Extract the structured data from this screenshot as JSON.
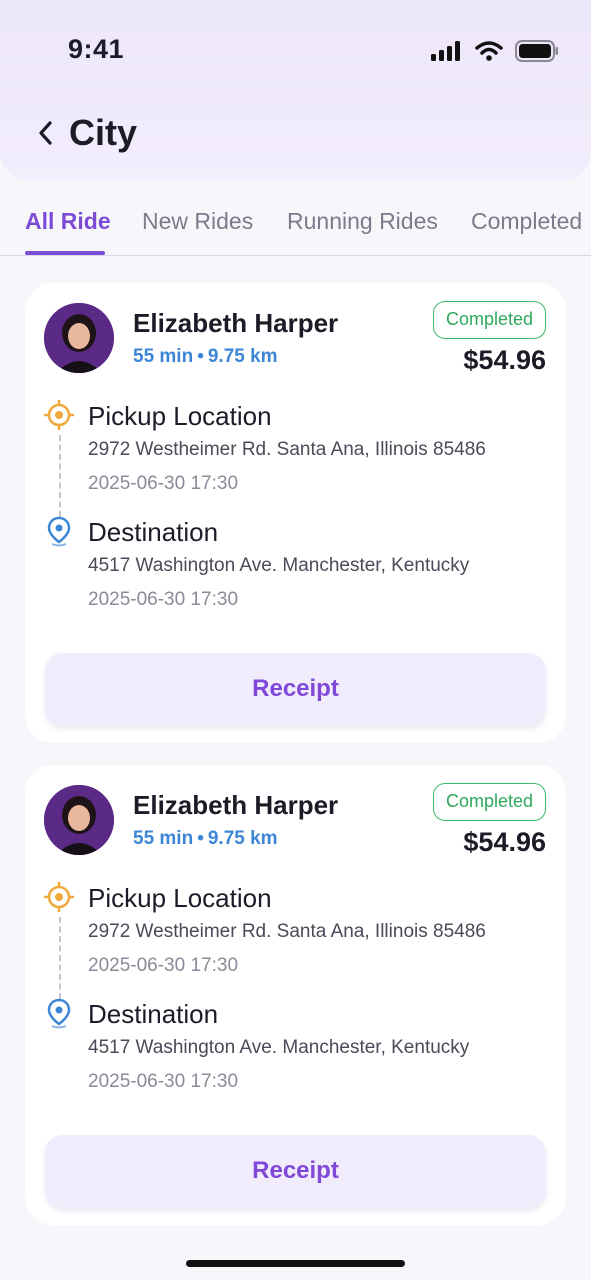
{
  "status_bar": {
    "time": "9:41"
  },
  "header": {
    "title": "City"
  },
  "tabs": [
    {
      "label": "All Ride",
      "active": true
    },
    {
      "label": "New Rides",
      "active": false
    },
    {
      "label": "Running Rides",
      "active": false
    },
    {
      "label": "Completed",
      "active": false
    }
  ],
  "rides": [
    {
      "rider_name": "Elizabeth Harper",
      "duration": "55 min",
      "separator": "•",
      "distance": "9.75 km",
      "status": "Completed",
      "fare": "$54.96",
      "pickup": {
        "title": "Pickup Location",
        "address": "2972 Westheimer Rd. Santa Ana, Illinois 85486",
        "time": "2025-06-30 17:30"
      },
      "destination": {
        "title": "Destination",
        "address": "4517 Washington Ave. Manchester, Kentucky",
        "time": "2025-06-30 17:30"
      },
      "receipt_label": "Receipt"
    },
    {
      "rider_name": "Elizabeth Harper",
      "duration": "55 min",
      "separator": "•",
      "distance": "9.75 km",
      "status": "Completed",
      "fare": "$54.96",
      "pickup": {
        "title": "Pickup Location",
        "address": "2972 Westheimer Rd. Santa Ana, Illinois 85486",
        "time": "2025-06-30 17:30"
      },
      "destination": {
        "title": "Destination",
        "address": "4517 Washington Ave. Manchester, Kentucky",
        "time": "2025-06-30 17:30"
      },
      "receipt_label": "Receipt"
    }
  ],
  "colors": {
    "accent": "#7c4bd6",
    "meta": "#3d86d6",
    "status_green": "#2fa95c",
    "pickup_icon": "#f0a93a",
    "destination_icon": "#3d86d6"
  },
  "icons": [
    "signal-icon",
    "wifi-icon",
    "battery-icon",
    "back-chevron-icon",
    "pickup-target-icon",
    "destination-pin-icon"
  ]
}
